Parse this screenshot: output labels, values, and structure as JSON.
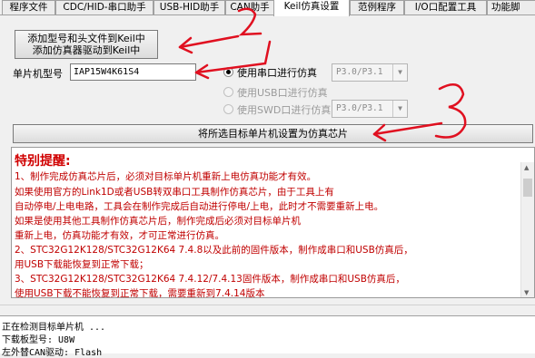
{
  "tabs": [
    {
      "label": "程序文件"
    },
    {
      "label": "CDC/HID-串口助手"
    },
    {
      "label": "USB-HID助手"
    },
    {
      "label": "CAN助手"
    },
    {
      "label": "Keil仿真设置"
    },
    {
      "label": "范例程序"
    },
    {
      "label": "I/O口配置工具"
    },
    {
      "label": "功能脚"
    }
  ],
  "active_tab": "Keil仿真设置",
  "add_button": {
    "line1": "添加型号和头文件到Keil中",
    "line2": "添加仿真器驱动到Keil中"
  },
  "mcu_label": "单片机型号",
  "mcu_value": "IAP15W4K61S4",
  "serial_option": {
    "label": "使用串口进行仿真",
    "selected": true,
    "port": "P3.0/P3.1"
  },
  "usb_option": {
    "label": "使用USB口进行仿真",
    "selected": false
  },
  "swd_option": {
    "label": "使用SWD口进行仿真",
    "selected": false,
    "port": "P3.0/P3.1"
  },
  "set_chip_button": "将所选目标单片机设置为仿真芯片",
  "info": {
    "title": "特别提醒:",
    "lines": [
      "1、制作完成仿真芯片后，必须对目标单片机重新上电仿真功能才有效。",
      "   如果使用官方的Link1D或者USB转双串口工具制作仿真芯片，由于工具上有",
      "   自动停电/上电电路，工具会在制作完成后自动进行停电/上电，此时才不需要重新上电。",
      "   如果是使用其他工具制作仿真芯片后，制作完成后必须对目标单片机",
      "   重新上电，仿真功能才有效，才可正常进行仿真。",
      "2、STC32G12K128/STC32G12K64   7.4.8以及此前的固件版本，制作成串口和USB仿真后，",
      "   用USB下载能恢复到正常下载；",
      "3、STC32G12K128/STC32G12K64   7.4.12/7.4.13固件版本，制作成串口和USB仿真后，",
      "   使用USB下载不能恢复到正常下载，需要重新到7.4.14版本"
    ]
  },
  "log": {
    "lines": [
      "正在检测目标单片机 ...",
      "  下载板型号: U8W",
      "  左外替CAN驱动: Flash"
    ]
  },
  "annotations": {
    "color": "#e01020",
    "numbers": [
      "2",
      "3"
    ]
  }
}
